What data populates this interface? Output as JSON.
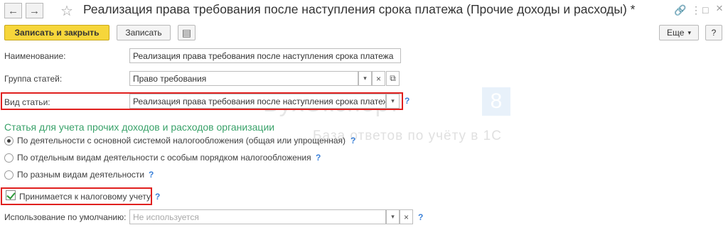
{
  "window": {
    "title": "Реализация права требования после наступления срока платежа (Прочие доходы и расходы) *",
    "back_icon": "←",
    "forward_icon": "→",
    "star_icon": "☆",
    "link_icon": "🔗",
    "menu_icon": "⋮",
    "maximize_icon": "□",
    "close_icon": "×"
  },
  "toolbar": {
    "save_close": "Записать и закрыть",
    "save": "Записать",
    "list_icon": "▤",
    "more": "Еще",
    "more_arrow": "▾",
    "help": "?"
  },
  "form": {
    "name_label": "Наименование:",
    "name_value": "Реализация права требования после наступления срока платежа",
    "group_label": "Группа статей:",
    "group_value": "Право требования",
    "type_label": "Вид статьи:",
    "type_value": "Реализация права требования после наступления срока платеж",
    "section_title": "Статья для учета прочих доходов и расходов организации",
    "radio_options": [
      "По деятельности с основной системой налогообложения (общая или упрощенная)",
      "По отдельным видам деятельности с особым порядком налогообложения",
      "По разным видам деятельности"
    ],
    "tax_checkbox": "Принимается к налоговому учету",
    "default_label": "Использование по умолчанию:",
    "default_placeholder": "Не используется",
    "dropdown_icon": "▾",
    "clear_icon": "×",
    "open_icon": "⧉",
    "help_icon": "?"
  },
  "watermark": {
    "brand": "БухЭксперт",
    "tagline": "База ответов по учёту в 1С",
    "number": "8"
  }
}
